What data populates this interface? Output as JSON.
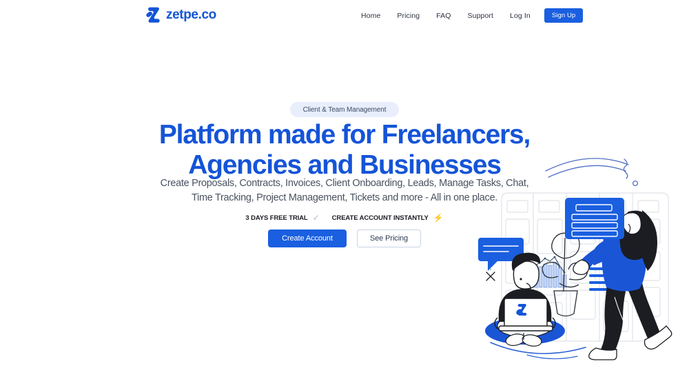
{
  "brand": {
    "name": "zetpe.co",
    "logo_icon": "z-logo-icon",
    "color": "#1355d6"
  },
  "nav": {
    "items": [
      {
        "label": "Home",
        "key": "home"
      },
      {
        "label": "Pricing",
        "key": "pricing"
      },
      {
        "label": "FAQ",
        "key": "faq"
      },
      {
        "label": "Support",
        "key": "support"
      },
      {
        "label": "Log In",
        "key": "login"
      }
    ],
    "signup_label": "Sign Up",
    "signup_color": "#1a5fe0"
  },
  "hero": {
    "pill_label": "Client & Team Management",
    "headline_line1": "Platform made for Freelancers,",
    "headline_line2": "Agencies and Businesses",
    "headline_color": "#1554d8",
    "subhead_line1": "Create Proposals, Contracts, Invoices, Client Onboarding, Leads, Manage Tasks, Chat,",
    "subhead_line2": "Time Tracking, Project Management, Tickets and more - All in one place.",
    "badge_trial": "3 DAYS FREE TRIAL",
    "badge_trial_icon": "check-icon",
    "badge_instant": "CREATE ACCOUNT INSTANTLY",
    "badge_instant_icon": "lightning-bolt-icon",
    "cta_primary": "Create Account",
    "cta_secondary": "See Pricing"
  },
  "illustration": {
    "name": "team-collaboration-kanban-illustration",
    "accent_color": "#1a5fe0",
    "elements": [
      "kanban-board",
      "woman-placing-card",
      "man-with-laptop",
      "chat-bubble",
      "bar-chart",
      "potted-plant",
      "decorative-arcs",
      "laptop-z-logo"
    ]
  }
}
